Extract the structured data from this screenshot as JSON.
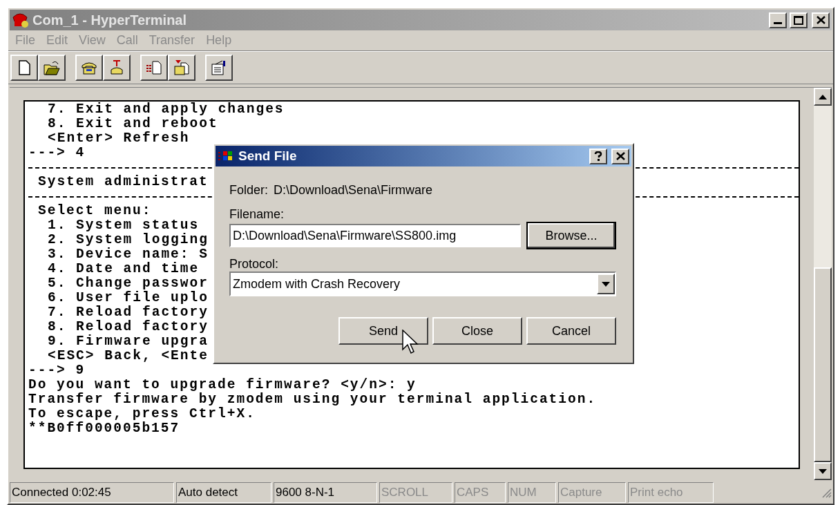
{
  "window": {
    "title": "Com_1 - HyperTerminal",
    "active": false
  },
  "menu": [
    {
      "label": "File",
      "disabled": true
    },
    {
      "label": "Edit",
      "disabled": true
    },
    {
      "label": "View",
      "disabled": true
    },
    {
      "label": "Call",
      "disabled": true
    },
    {
      "label": "Transfer",
      "disabled": true
    },
    {
      "label": "Help",
      "disabled": true
    }
  ],
  "toolbar": [
    {
      "kind": "new"
    },
    {
      "kind": "open",
      "gap_after": true
    },
    {
      "kind": "connect"
    },
    {
      "kind": "disconnect",
      "gap_after": true
    },
    {
      "kind": "send"
    },
    {
      "kind": "receive",
      "gap_after": true
    },
    {
      "kind": "properties"
    }
  ],
  "terminal": {
    "lines": [
      {
        "kind": "item",
        "text": "7. Exit and apply changes"
      },
      {
        "kind": "item",
        "text": "8. Exit and reboot"
      },
      {
        "kind": "item",
        "text": "<Enter> Refresh"
      },
      {
        "kind": "plain",
        "text": "---> 4"
      },
      {
        "kind": "divider"
      },
      {
        "kind": "heading",
        "text": "System administrat"
      },
      {
        "kind": "divider"
      },
      {
        "kind": "heading",
        "text": "Select menu:"
      },
      {
        "kind": "item",
        "text": "1. System status"
      },
      {
        "kind": "item",
        "text": "2. System logging"
      },
      {
        "kind": "item",
        "text": "3. Device name: S"
      },
      {
        "kind": "item",
        "text": "4. Date and time"
      },
      {
        "kind": "item",
        "text": "5. Change passwor"
      },
      {
        "kind": "item",
        "text": "6. User file uplo"
      },
      {
        "kind": "item",
        "text": "7. Reload factory"
      },
      {
        "kind": "item",
        "text": "8. Reload factory"
      },
      {
        "kind": "item",
        "text": "9. Firmware upgra"
      },
      {
        "kind": "item",
        "text": "<ESC> Back, <Ente"
      },
      {
        "kind": "plain",
        "text": "---> 9"
      },
      {
        "kind": "plain",
        "text": "Do you want to upgrade firmware? <y/n>: y"
      },
      {
        "kind": "plain",
        "text": "Transfer firmware by zmodem using your terminal application."
      },
      {
        "kind": "plain",
        "text": "To escape, press Ctrl+X."
      },
      {
        "kind": "plain",
        "text": "**B0ff000005b157"
      }
    ]
  },
  "dialog": {
    "title": "Send File",
    "active": true,
    "folder_label": "Folder:",
    "folder": "D:\\Download\\Sena\\Firmware",
    "filename_label": "Filename:",
    "filename": "D:\\Download\\Sena\\Firmware\\SS800.img",
    "browse": "Browse...",
    "protocol_label": "Protocol:",
    "protocol": "Zmodem with Crash Recovery",
    "buttons": [
      "Send",
      "Close",
      "Cancel"
    ]
  },
  "status_bar": [
    {
      "text": "Connected 0:02:45",
      "disabled": false
    },
    {
      "text": "Auto detect",
      "disabled": false
    },
    {
      "text": "9600 8-N-1",
      "disabled": false
    },
    {
      "text": "SCROLL",
      "disabled": true
    },
    {
      "text": "CAPS",
      "disabled": true
    },
    {
      "text": "NUM",
      "disabled": true
    },
    {
      "text": "Capture",
      "disabled": true
    },
    {
      "text": "Print echo",
      "disabled": true
    }
  ]
}
